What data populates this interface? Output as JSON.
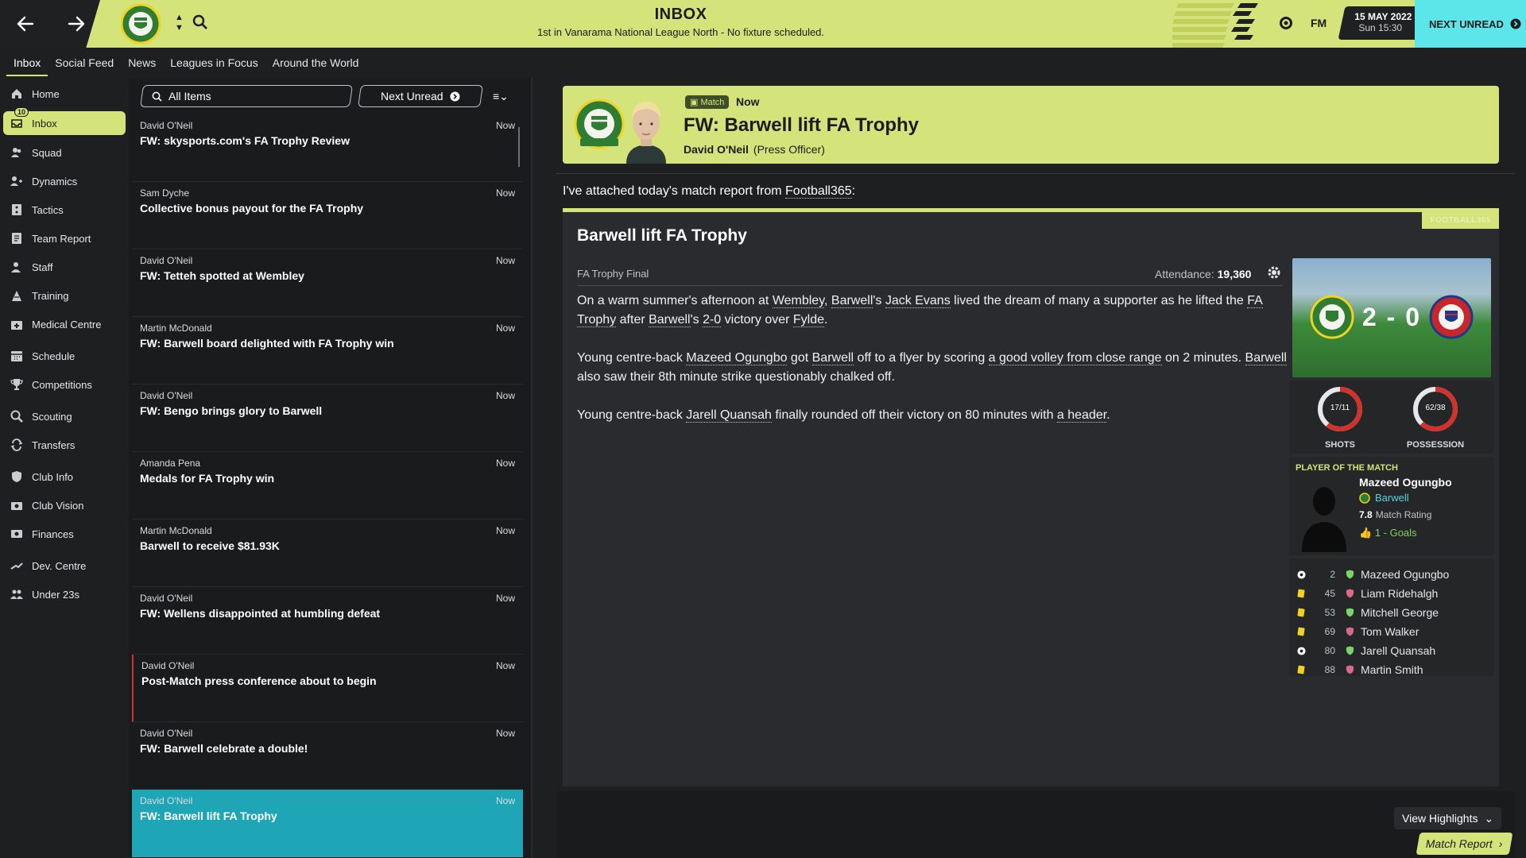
{
  "topbar": {
    "title": "INBOX",
    "subtitle": "1st in Vanarama National League North - No fixture scheduled.",
    "fm_label": "FM",
    "date": "15 MAY 2022",
    "time": "Sun 15:30",
    "next_unread": "NEXT UNREAD"
  },
  "subnav": {
    "tabs": [
      "Inbox",
      "Social Feed",
      "News",
      "Leagues in Focus",
      "Around the World"
    ]
  },
  "sidebar": {
    "inbox_badge": "10",
    "items": [
      {
        "label": "Home",
        "icon": "home-icon"
      },
      {
        "label": "Inbox",
        "icon": "inbox-icon"
      },
      {
        "label": "Squad",
        "icon": "squad-icon"
      },
      {
        "label": "Dynamics",
        "icon": "dynamics-icon"
      },
      {
        "label": "Tactics",
        "icon": "tactics-icon"
      },
      {
        "label": "Team Report",
        "icon": "report-icon"
      },
      {
        "label": "Staff",
        "icon": "staff-icon"
      },
      {
        "label": "Training",
        "icon": "training-icon"
      },
      {
        "label": "Medical Centre",
        "icon": "medical-icon"
      },
      {
        "label": "Schedule",
        "icon": "calendar-icon"
      },
      {
        "label": "Competitions",
        "icon": "trophy-icon"
      },
      {
        "label": "Scouting",
        "icon": "search-icon"
      },
      {
        "label": "Transfers",
        "icon": "transfer-icon"
      },
      {
        "label": "Club Info",
        "icon": "shield-icon"
      },
      {
        "label": "Club Vision",
        "icon": "vision-icon"
      },
      {
        "label": "Finances",
        "icon": "money-icon"
      },
      {
        "label": "Dev. Centre",
        "icon": "dev-icon"
      },
      {
        "label": "Under 23s",
        "icon": "u23-icon"
      }
    ]
  },
  "list": {
    "filter_label": "All Items",
    "next_unread_label": "Next Unread",
    "messages": [
      {
        "from": "David O'Neil",
        "subject": "FW: skysports.com's FA Trophy Review",
        "time": "Now"
      },
      {
        "from": "Sam Dyche",
        "subject": "Collective bonus payout for the FA Trophy",
        "time": "Now"
      },
      {
        "from": "David O'Neil",
        "subject": "FW: Tetteh spotted at Wembley",
        "time": "Now"
      },
      {
        "from": "Martin McDonald",
        "subject": "FW: Barwell board delighted with FA Trophy win",
        "time": "Now"
      },
      {
        "from": "David O'Neil",
        "subject": "FW: Bengo brings glory to Barwell",
        "time": "Now"
      },
      {
        "from": "Amanda Pena",
        "subject": "Medals for FA Trophy win",
        "time": "Now"
      },
      {
        "from": "Martin McDonald",
        "subject": "Barwell to receive $81.93K",
        "time": "Now"
      },
      {
        "from": "David O'Neil",
        "subject": "FW: Wellens disappointed at humbling defeat",
        "time": "Now"
      },
      {
        "from": "David O'Neil",
        "subject": "Post-Match press conference about to begin",
        "time": "Now"
      },
      {
        "from": "David O'Neil",
        "subject": "FW: Barwell celebrate a double!",
        "time": "Now"
      },
      {
        "from": "David O'Neil",
        "subject": "FW: Barwell lift FA Trophy",
        "time": "Now"
      }
    ]
  },
  "message": {
    "chip": "Match",
    "when": "Now",
    "title": "FW: Barwell lift FA Trophy",
    "sender": "David O'Neil",
    "role": "(Press Officer)",
    "intro_pre": "I've attached today's match report from ",
    "intro_link": "Football365",
    "intro_post": ":"
  },
  "report": {
    "brand": "FOOTBALL365",
    "title": "Barwell lift FA Trophy",
    "competition": "FA Trophy Final",
    "attendance_label": "Attendance:",
    "attendance_value": "19,360",
    "score": "2 - 0",
    "p1": [
      {
        "t": "On a warm summer's afternoon at ",
        "u": false
      },
      {
        "t": "Wembley",
        "u": true
      },
      {
        "t": ", ",
        "u": false
      },
      {
        "t": "Barwell",
        "u": true
      },
      {
        "t": "'s ",
        "u": false
      },
      {
        "t": "Jack Evans",
        "u": true
      },
      {
        "t": " lived the dream of many a supporter as he lifted the ",
        "u": false
      },
      {
        "t": "FA Trophy",
        "u": true
      },
      {
        "t": " after ",
        "u": false
      },
      {
        "t": "Barwell",
        "u": true
      },
      {
        "t": "'s ",
        "u": false
      },
      {
        "t": "2-0",
        "u": true
      },
      {
        "t": " victory over ",
        "u": false
      },
      {
        "t": "Fylde",
        "u": true
      },
      {
        "t": ".",
        "u": false
      }
    ],
    "p2": [
      {
        "t": "Young centre-back ",
        "u": false
      },
      {
        "t": "Mazeed Ogungbo",
        "u": true
      },
      {
        "t": " got ",
        "u": false
      },
      {
        "t": "Barwell",
        "u": true
      },
      {
        "t": " off to a flyer by scoring ",
        "u": false
      },
      {
        "t": "a good volley from close range",
        "u": true
      },
      {
        "t": " on 2 minutes. ",
        "u": false
      },
      {
        "t": "Barwell",
        "u": true
      },
      {
        "t": " also saw their 8th minute strike questionably chalked off.",
        "u": false
      }
    ],
    "p3": [
      {
        "t": "Young centre-back ",
        "u": false
      },
      {
        "t": "Jarell Quansah",
        "u": true
      },
      {
        "t": " finally rounded off their victory on 80 minutes with ",
        "u": false
      },
      {
        "t": "a header",
        "u": true
      },
      {
        "t": ".",
        "u": false
      }
    ],
    "stats": [
      {
        "label": "SHOTS",
        "value": "17/11",
        "home_share": 0.607
      },
      {
        "label": "POSSESSION",
        "value": "62/38",
        "home_share": 0.62
      }
    ],
    "potm": {
      "title": "PLAYER OF THE MATCH",
      "name": "Mazeed Ogungbo",
      "club": "Barwell",
      "rating": "7.8",
      "rating_label": "Match Rating",
      "goals": "1 - Goals"
    },
    "events": [
      {
        "type": "goal",
        "minute": "2",
        "team": "home",
        "player": "Mazeed Ogungbo"
      },
      {
        "type": "yellow",
        "minute": "45",
        "team": "away",
        "player": "Liam Ridehalgh"
      },
      {
        "type": "yellow",
        "minute": "53",
        "team": "home",
        "player": "Mitchell George"
      },
      {
        "type": "yellow",
        "minute": "69",
        "team": "away",
        "player": "Tom Walker"
      },
      {
        "type": "goal",
        "minute": "80",
        "team": "home",
        "player": "Jarell Quansah"
      },
      {
        "type": "yellow",
        "minute": "88",
        "team": "away",
        "player": "Martin Smith"
      }
    ]
  },
  "footer": {
    "highlights": "View Highlights",
    "match_report": "Match Report"
  },
  "colors": {
    "accent": "#d4e37a",
    "selected": "#1ea6b6",
    "cyan": "#5ce6ea",
    "ring": "#d3312b"
  }
}
